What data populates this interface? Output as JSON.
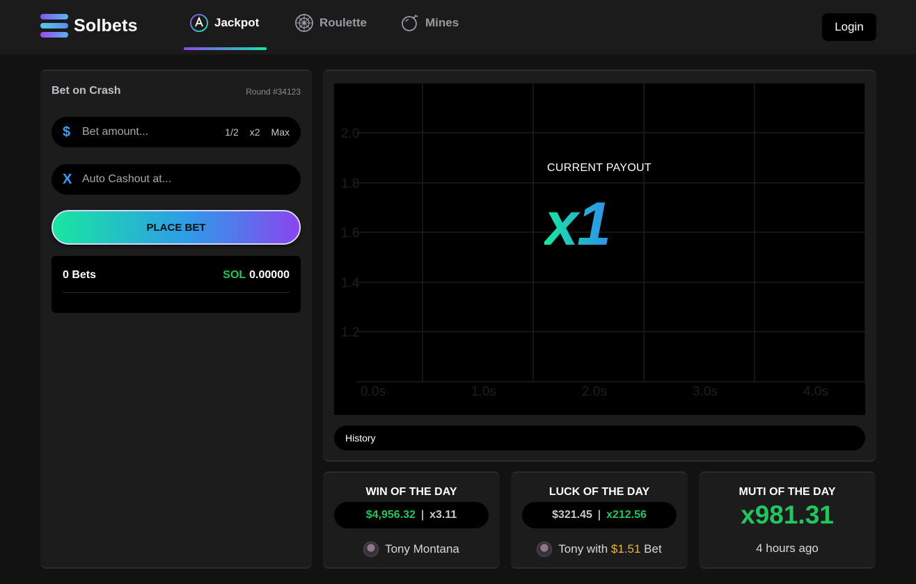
{
  "app": {
    "name": "Solbets"
  },
  "nav": {
    "items": [
      {
        "label": "Jackpot",
        "icon": "jackpot-icon",
        "active": true
      },
      {
        "label": "Roulette",
        "icon": "roulette-icon",
        "active": false
      },
      {
        "label": "Mines",
        "icon": "mines-icon",
        "active": false
      }
    ],
    "login_label": "Login"
  },
  "bet_panel": {
    "title": "Bet on Crash",
    "round": "Round #34123",
    "bet_amount": {
      "prefix": "$",
      "placeholder": "Bet amount...",
      "value": ""
    },
    "quick": {
      "half": "1/2",
      "double": "x2",
      "max": "Max"
    },
    "auto_cashout": {
      "prefix": "X",
      "placeholder": "Auto Cashout at...",
      "value": ""
    },
    "place_bet_label": "PLACE BET",
    "bets_count": "0 Bets",
    "currency": "SOL",
    "total": "0.00000"
  },
  "game": {
    "payout_label": "CURRENT PAYOUT",
    "payout_value": "x1",
    "history_label": "History",
    "chart": {
      "y_ticks": [
        "2.0",
        "1.8",
        "1.6",
        "1.4",
        "1.2"
      ],
      "x_ticks": [
        "0.0s",
        "1.0s",
        "2.0s",
        "3.0s",
        "4.0s"
      ]
    }
  },
  "stats": {
    "win": {
      "title": "WIN OF THE DAY",
      "amount": "$4,956.32",
      "sep": "|",
      "multiplier": "x3.11",
      "user": "Tony Montana"
    },
    "luck": {
      "title": "LUCK OF THE DAY",
      "amount": "$321.45",
      "sep": "|",
      "multiplier": "x212.56",
      "user_prefix": "Tony with",
      "bet": "$1.51",
      "user_suffix": "Bet"
    },
    "multi": {
      "title": "MUTI OF THE DAY",
      "value": "x981.31",
      "time": "4 hours ago"
    }
  },
  "colors": {
    "background": "#121212",
    "panel": "#1c1c1c",
    "green": "#22c55e",
    "gold": "#e6b833",
    "accent_purple": "#8a45ee",
    "accent_teal": "#19e6a0"
  }
}
